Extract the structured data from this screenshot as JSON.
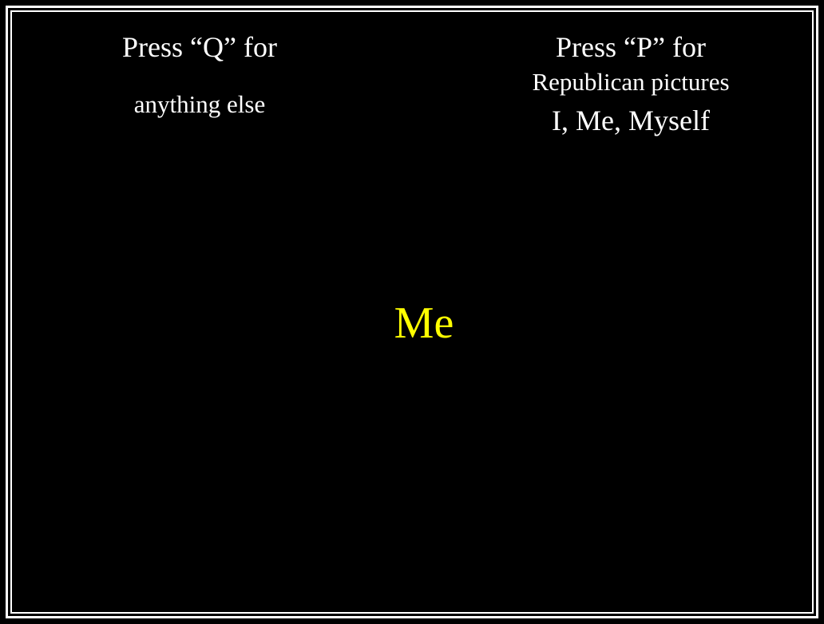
{
  "left_panel": {
    "key_prompt": "Press “Q” for",
    "category": "anything else"
  },
  "right_panel": {
    "key_prompt": "Press “P” for",
    "category_primary": "Republican pictures",
    "category_secondary": "I, Me, Myself"
  },
  "stimulus": {
    "word": "Me",
    "color": "#ffff00"
  },
  "colors": {
    "background": "#000000",
    "text": "#ffffff",
    "border": "#ffffff"
  }
}
